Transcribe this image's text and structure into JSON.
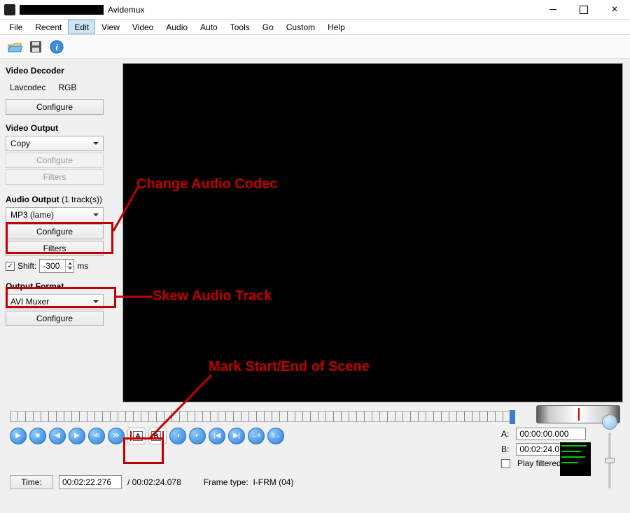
{
  "title": {
    "app": "Avidemux"
  },
  "menu": {
    "items": [
      "File",
      "Recent",
      "Edit",
      "View",
      "Video",
      "Audio",
      "Auto",
      "Tools",
      "Go",
      "Custom",
      "Help"
    ],
    "highlighted": "Edit"
  },
  "sidebar": {
    "video_decoder": {
      "heading": "Video Decoder",
      "decoder1": "Lavcodec",
      "decoder2": "RGB",
      "configure": "Configure"
    },
    "video_output": {
      "heading": "Video Output",
      "codec": "Copy",
      "configure": "Configure",
      "filters": "Filters"
    },
    "audio_output": {
      "heading": "Audio Output",
      "tracks_suffix": "(1 track(s))",
      "codec": "MP3 (lame)",
      "configure": "Configure",
      "filters": "Filters",
      "shift_label": "Shift:",
      "shift_value": "-300",
      "shift_unit": "ms",
      "shift_checked": true
    },
    "output_format": {
      "heading": "Output Format",
      "muxer": "AVI Muxer",
      "configure": "Configure"
    }
  },
  "timeline": {
    "a_label": "A:",
    "a_value": "00:00:00.000",
    "b_label": "B:",
    "b_value": "00:02:24.078",
    "play_filtered": "Play filtered"
  },
  "time_row": {
    "time_label": "Time:",
    "current": "00:02:22.276",
    "total_prefix": "/ ",
    "total": "00:02:24.078",
    "frame_type_label": "Frame type:",
    "frame_type_value": "I-FRM (04)"
  },
  "annotations": {
    "codec": "Change Audio Codec",
    "skew": "Skew Audio Track",
    "mark": "Mark Start/End of Scene"
  }
}
